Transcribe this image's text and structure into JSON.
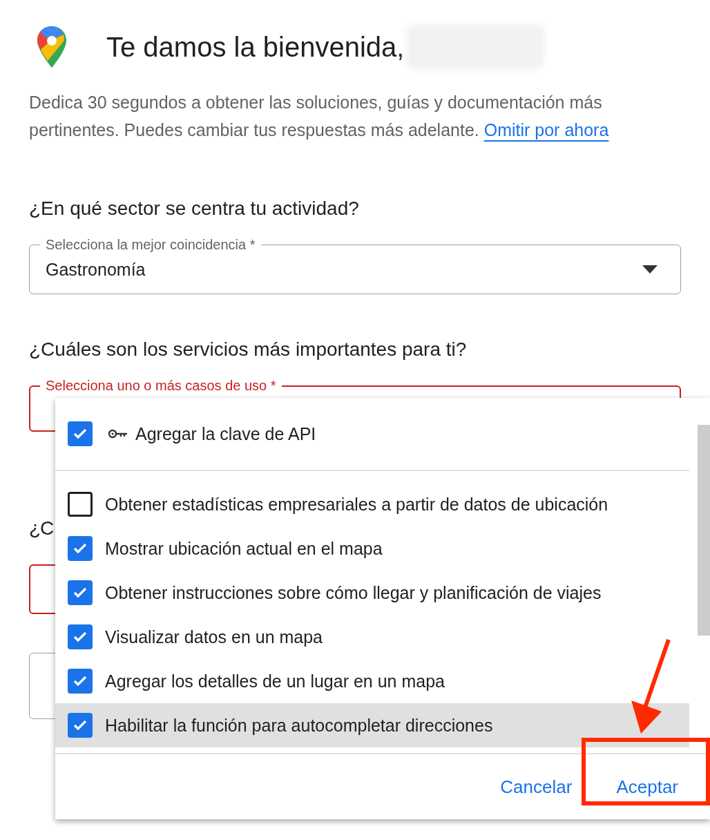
{
  "header": {
    "title": "Te damos la bienvenida,"
  },
  "intro": {
    "text": "Dedica 30 segundos a obtener las soluciones, guías y documentación más pertinentes. Puedes cambiar tus respuestas más adelante.",
    "link": "Omitir por ahora"
  },
  "questions": [
    {
      "text": "¿En qué sector se centra tu actividad?",
      "field": {
        "label": "Selecciona la mejor coincidencia *",
        "value": "Gastronomía",
        "error": false
      }
    },
    {
      "text": "¿Cuáles son los servicios más importantes para ti?",
      "field": {
        "label": "Selecciona uno o más casos de uso *",
        "error": true
      }
    },
    {
      "text": "¿C",
      "field": {
        "error": true
      }
    },
    {
      "field": {
        "error": false
      }
    }
  ],
  "menu": {
    "items": [
      {
        "kind": "key",
        "label": "Agregar la clave de API",
        "checked": true,
        "highlighted": false
      },
      {
        "kind": "option",
        "label": "Obtener estadísticas empresariales a partir de datos de ubicación",
        "checked": false,
        "highlighted": false
      },
      {
        "kind": "option",
        "label": "Mostrar ubicación actual en el mapa",
        "checked": true,
        "highlighted": false
      },
      {
        "kind": "option",
        "label": "Obtener instrucciones sobre cómo llegar y planificación de viajes",
        "checked": true,
        "highlighted": false
      },
      {
        "kind": "option",
        "label": "Visualizar datos en un mapa",
        "checked": true,
        "highlighted": false
      },
      {
        "kind": "option",
        "label": "Agregar los detalles de un lugar en un mapa",
        "checked": true,
        "highlighted": false
      },
      {
        "kind": "option",
        "label": "Habilitar la función para autocompletar direcciones",
        "checked": true,
        "highlighted": true
      }
    ],
    "buttons": [
      {
        "label": "Cancelar",
        "annotated": false
      },
      {
        "label": "Aceptar",
        "annotated": true
      }
    ]
  }
}
